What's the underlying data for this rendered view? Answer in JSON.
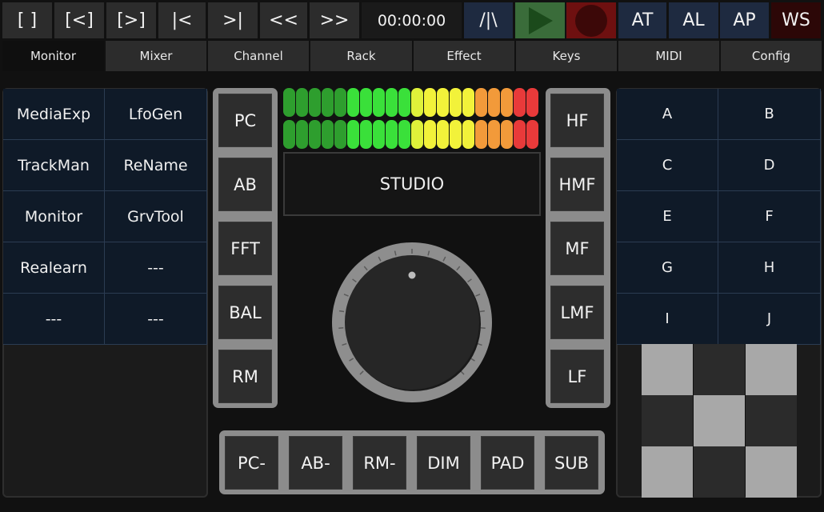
{
  "toolbar": {
    "buttons": [
      "[ ]",
      "[<]",
      "[>]",
      "|<",
      ">|",
      "<<",
      ">>"
    ],
    "time": "00:00:00",
    "automation_label": "/|\\",
    "at_label": "AT",
    "al_label": "AL",
    "ap_label": "AP",
    "ws_label": "WS",
    "play_icon": "play-icon",
    "record_icon": "record-icon"
  },
  "tabs": [
    "Monitor",
    "Mixer",
    "Channel",
    "Rack",
    "Effect",
    "Keys",
    "MIDI",
    "Config"
  ],
  "active_tab": "Monitor",
  "left_grid": [
    [
      "MediaExp",
      "LfoGen"
    ],
    [
      "TrackMan",
      "ReName"
    ],
    [
      "Monitor",
      "GrvTool"
    ],
    [
      "Realearn",
      "---"
    ],
    [
      "---",
      "---"
    ]
  ],
  "left_stack": [
    "PC",
    "AB",
    "FFT",
    "BAL",
    "RM"
  ],
  "right_stack": [
    "HF",
    "HMF",
    "MF",
    "LMF",
    "LF"
  ],
  "display_label": "STUDIO",
  "bottom_buttons": [
    "PC-",
    "AB-",
    "RM-",
    "DIM",
    "PAD",
    "SUB"
  ],
  "right_grid": [
    [
      "A",
      "B"
    ],
    [
      "C",
      "D"
    ],
    [
      "E",
      "F"
    ],
    [
      "G",
      "H"
    ],
    [
      "I",
      "J"
    ]
  ],
  "meter": {
    "segment_colors": [
      "#2e9e2e",
      "#2e9e2e",
      "#2e9e2e",
      "#2e9e2e",
      "#2e9e2e",
      "#3ae03a",
      "#3ae03a",
      "#3ae03a",
      "#3ae03a",
      "#3ae03a",
      "#dff23a",
      "#f2f23a",
      "#f2f23a",
      "#f2f23a",
      "#f2f23a",
      "#f29a3a",
      "#f29a3a",
      "#f29a3a",
      "#e83a3a",
      "#e83a3a"
    ]
  },
  "xy_pad_pattern": [
    [
      "light",
      "dark",
      "light"
    ],
    [
      "dark",
      "light",
      "dark"
    ],
    [
      "light",
      "dark",
      "light"
    ]
  ],
  "colors": {
    "background": "#111111",
    "grid_cell": "#0f1a28",
    "play": "#3a6c3a",
    "record": "#6e1010"
  }
}
